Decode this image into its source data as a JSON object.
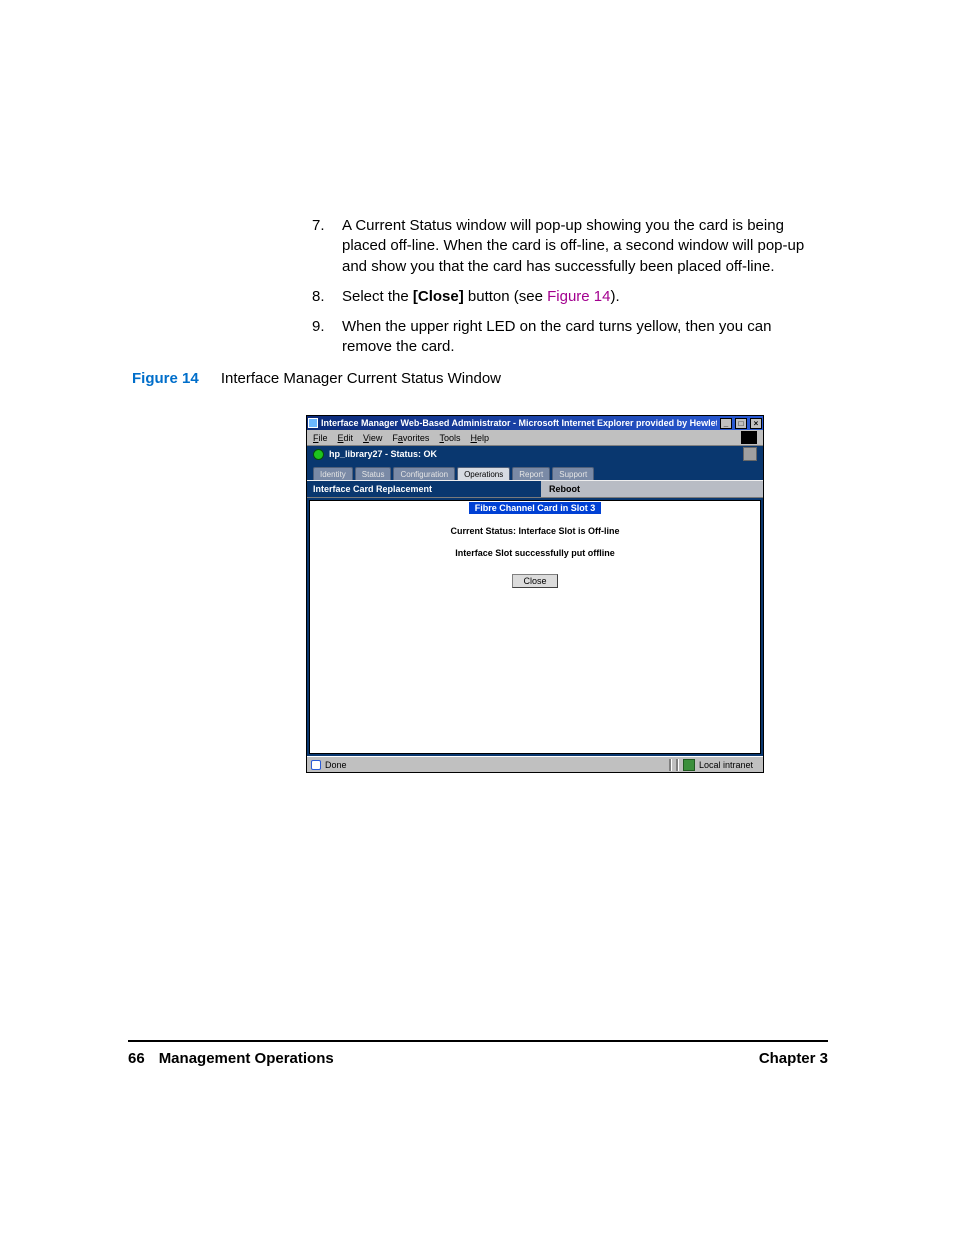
{
  "steps": [
    {
      "num": "7.",
      "text": "A Current Status window will pop-up showing you the card is being placed off-line. When the card is off-line, a second window will pop-up and show you that the card has successfully been placed off-line."
    },
    {
      "num": "8.",
      "pre": "Select the ",
      "bold": "[Close]",
      "post": " button (see ",
      "link": "Figure 14",
      "tail": ")."
    },
    {
      "num": "9.",
      "text": "When the upper right LED on the card turns yellow, then you can remove the card."
    }
  ],
  "figure": {
    "label": "Figure 14",
    "caption": "Interface Manager Current Status Window"
  },
  "window": {
    "title": "Interface Manager Web-Based Administrator - Microsoft Internet Explorer provided by Hewlett-P...",
    "menus": [
      "File",
      "Edit",
      "View",
      "Favorites",
      "Tools",
      "Help"
    ],
    "status_text": "hp_library27 - Status: OK",
    "tabs": [
      "Identity",
      "Status",
      "Configuration",
      "Operations",
      "Report",
      "Support"
    ],
    "active_tab": "Operations",
    "sub_left": "Interface Card Replacement",
    "sub_right": "Reboot",
    "banner": "Fibre Channel Card in Slot 3",
    "line1": "Current Status: Interface Slot is Off-line",
    "line2": "Interface Slot successfully put offline",
    "close": "Close",
    "ie_done": "Done",
    "ie_zone": "Local intranet"
  },
  "footer": {
    "page": "66",
    "section": "Management Operations",
    "chapter": "Chapter 3"
  }
}
